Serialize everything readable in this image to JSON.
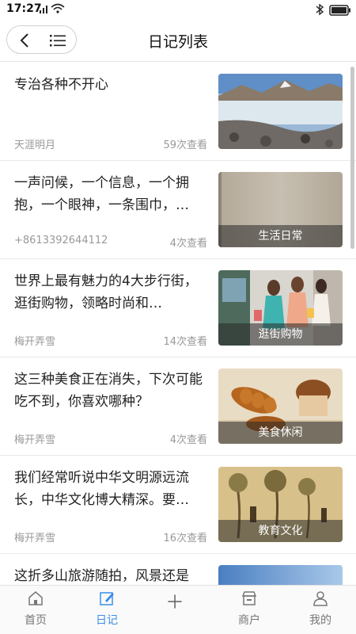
{
  "status_bar": {
    "time": "17:27",
    "network": "4G"
  },
  "header": {
    "title": "日记列表"
  },
  "list": [
    {
      "title": "专治各种不开心",
      "author": "天涯明月",
      "views": "59次查看",
      "caption": ""
    },
    {
      "title": "一声问候，一个信息，一个拥抱，一个眼神，一条围巾，…",
      "author": "+8613392644112",
      "views": "4次查看",
      "caption": "生活日常"
    },
    {
      "title": "世界上最有魅力的4大步行街，逛街购物，领略时尚和…",
      "author": "梅开弄雪",
      "views": "14次查看",
      "caption": "逛街购物"
    },
    {
      "title": "这三种美食正在消失，下次可能吃不到，你喜欢哪种？",
      "author": "梅开弄雪",
      "views": "4次查看",
      "caption": "美食休闲"
    },
    {
      "title": "我们经常听说中华文明源远流长，中华文化博大精深。要…",
      "author": "梅开弄雪",
      "views": "16次查看",
      "caption": "教育文化"
    },
    {
      "title": "这折多山旅游随拍，风景还是",
      "author": "",
      "views": "",
      "caption": ""
    }
  ],
  "tabbar": [
    {
      "label": "首页",
      "icon": "home-icon"
    },
    {
      "label": "日记",
      "icon": "diary-icon"
    },
    {
      "label": "",
      "icon": "add-icon"
    },
    {
      "label": "商户",
      "icon": "shop-icon"
    },
    {
      "label": "我的",
      "icon": "profile-icon"
    }
  ],
  "colors": {
    "accent": "#3a8ee6",
    "muted": "#999999"
  }
}
